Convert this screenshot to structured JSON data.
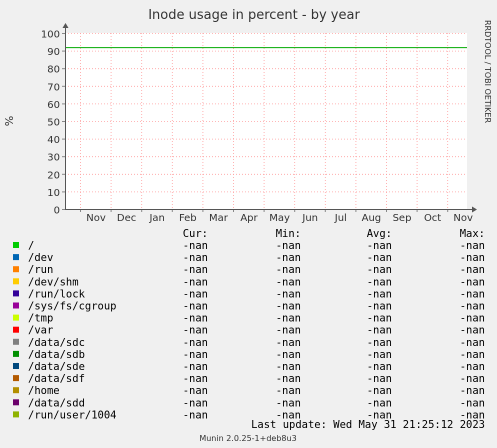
{
  "chart_data": {
    "type": "line",
    "title": "Inode usage in percent - by year",
    "ylabel": "%",
    "ylim": [
      0,
      100
    ],
    "yticks": [
      "0",
      "10",
      "20",
      "30",
      "40",
      "50",
      "60",
      "70",
      "80",
      "90",
      "100"
    ],
    "xticks": [
      "Nov",
      "Dec",
      "Jan",
      "Feb",
      "Mar",
      "Apr",
      "May",
      "Jun",
      "Jul",
      "Aug",
      "Sep",
      "Oct",
      "Nov"
    ],
    "grid": true,
    "hline": {
      "value": 92,
      "color": "#00aa00"
    },
    "side_label": "RRDTOOL / TOBI OETIKER",
    "legend_headers": {
      "cur": "Cur:",
      "min": "Min:",
      "avg": "Avg:",
      "max": "Max:"
    },
    "series": [
      {
        "name": "/",
        "color": "#00cc00",
        "cur": "-nan",
        "min": "-nan",
        "avg": "-nan",
        "max": "-nan"
      },
      {
        "name": "/dev",
        "color": "#0066b3",
        "cur": "-nan",
        "min": "-nan",
        "avg": "-nan",
        "max": "-nan"
      },
      {
        "name": "/run",
        "color": "#ff8000",
        "cur": "-nan",
        "min": "-nan",
        "avg": "-nan",
        "max": "-nan"
      },
      {
        "name": "/dev/shm",
        "color": "#ffcc00",
        "cur": "-nan",
        "min": "-nan",
        "avg": "-nan",
        "max": "-nan"
      },
      {
        "name": "/run/lock",
        "color": "#330099",
        "cur": "-nan",
        "min": "-nan",
        "avg": "-nan",
        "max": "-nan"
      },
      {
        "name": "/sys/fs/cgroup",
        "color": "#990099",
        "cur": "-nan",
        "min": "-nan",
        "avg": "-nan",
        "max": "-nan"
      },
      {
        "name": "/tmp",
        "color": "#ccff00",
        "cur": "-nan",
        "min": "-nan",
        "avg": "-nan",
        "max": "-nan"
      },
      {
        "name": "/var",
        "color": "#ff0000",
        "cur": "-nan",
        "min": "-nan",
        "avg": "-nan",
        "max": "-nan"
      },
      {
        "name": "/data/sdc",
        "color": "#808080",
        "cur": "-nan",
        "min": "-nan",
        "avg": "-nan",
        "max": "-nan"
      },
      {
        "name": "/data/sdb",
        "color": "#008f00",
        "cur": "-nan",
        "min": "-nan",
        "avg": "-nan",
        "max": "-nan"
      },
      {
        "name": "/data/sde",
        "color": "#00487d",
        "cur": "-nan",
        "min": "-nan",
        "avg": "-nan",
        "max": "-nan"
      },
      {
        "name": "/data/sdf",
        "color": "#b35a00",
        "cur": "-nan",
        "min": "-nan",
        "avg": "-nan",
        "max": "-nan"
      },
      {
        "name": "/home",
        "color": "#b38f00",
        "cur": "-nan",
        "min": "-nan",
        "avg": "-nan",
        "max": "-nan"
      },
      {
        "name": "/data/sdd",
        "color": "#6b006b",
        "cur": "-nan",
        "min": "-nan",
        "avg": "-nan",
        "max": "-nan"
      },
      {
        "name": "/run/user/1004",
        "color": "#8fb300",
        "cur": "-nan",
        "min": "-nan",
        "avg": "-nan",
        "max": "-nan"
      }
    ],
    "last_update": "Last update:  Wed May 31 21:25:12 2023",
    "footer": "Munin 2.0.25-1+deb8u3"
  }
}
